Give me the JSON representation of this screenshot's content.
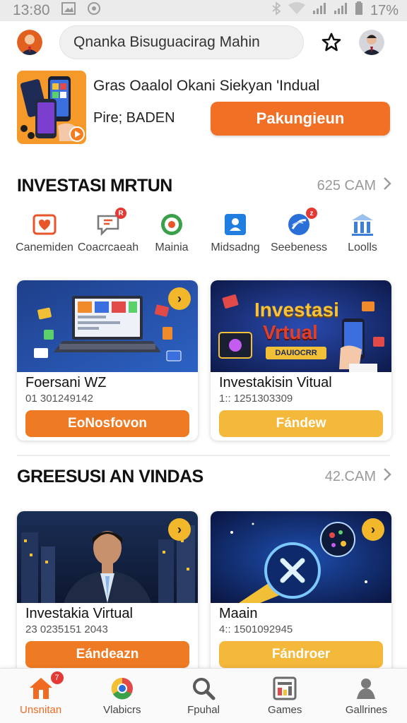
{
  "status_bar": {
    "time": "13:80",
    "battery": "17%"
  },
  "search": {
    "text": "Qnanka Bisuguacirag Mahin"
  },
  "promo": {
    "title": "Gras Oaalol Okani Siekyan 'Indual",
    "subtitle": "Pire; BADEN",
    "button_label": "Pakungieun"
  },
  "section1": {
    "title": "INVESTASI MRTUN",
    "more": "625 CAM",
    "categories": [
      {
        "label": "Canemiden",
        "icon": "heart-box-icon",
        "color": "#e8552a"
      },
      {
        "label": "Coacrcaeah",
        "icon": "chat-icon",
        "color": "#7a7a7a"
      },
      {
        "label": "Mainia",
        "icon": "map-pin-icon",
        "color": "#3aa04a"
      },
      {
        "label": "Midsadng",
        "icon": "person-card-icon",
        "color": "#1f7ee0"
      },
      {
        "label": "Seebeness",
        "icon": "compass-icon",
        "color": "#2a6fd8"
      },
      {
        "label": "Loolls",
        "icon": "bank-icon",
        "color": "#3d7fd8"
      }
    ],
    "cards": [
      {
        "title": "Foersani WZ",
        "sub": "01 301249142",
        "button": "EoNosfovon",
        "style": "orange"
      },
      {
        "title": "Investakisin Vitual",
        "sub": "1:: 1251303309",
        "button": "Fándew",
        "style": "yellow",
        "banner_title": "Investasi",
        "banner_title2": "Vrtual",
        "banner_tag": "DAUIOCRR"
      }
    ]
  },
  "section2": {
    "title": "GREESUSI AN VINDAS",
    "more": "42.CAM",
    "cards": [
      {
        "title": "Investakia Virtual",
        "sub": "23 0235151 2043",
        "button": "Eándeazn",
        "style": "orange"
      },
      {
        "title": "Maain",
        "sub": "4:: 1501092945",
        "button": "Fándroer",
        "style": "yellow"
      }
    ]
  },
  "bottom_nav": [
    {
      "label": "Unsnitan",
      "icon": "home-icon",
      "active": true,
      "badge": "7"
    },
    {
      "label": "Vlabicrs",
      "icon": "chrome-icon",
      "active": false
    },
    {
      "label": "Fpuhal",
      "icon": "search-icon",
      "active": false
    },
    {
      "label": "Games",
      "icon": "games-icon",
      "active": false
    },
    {
      "label": "Gallrines",
      "icon": "person-icon",
      "active": false
    }
  ],
  "colors": {
    "accent": "#f17025",
    "yellow": "#f4b83a",
    "link_grey": "#9a9a9a"
  }
}
